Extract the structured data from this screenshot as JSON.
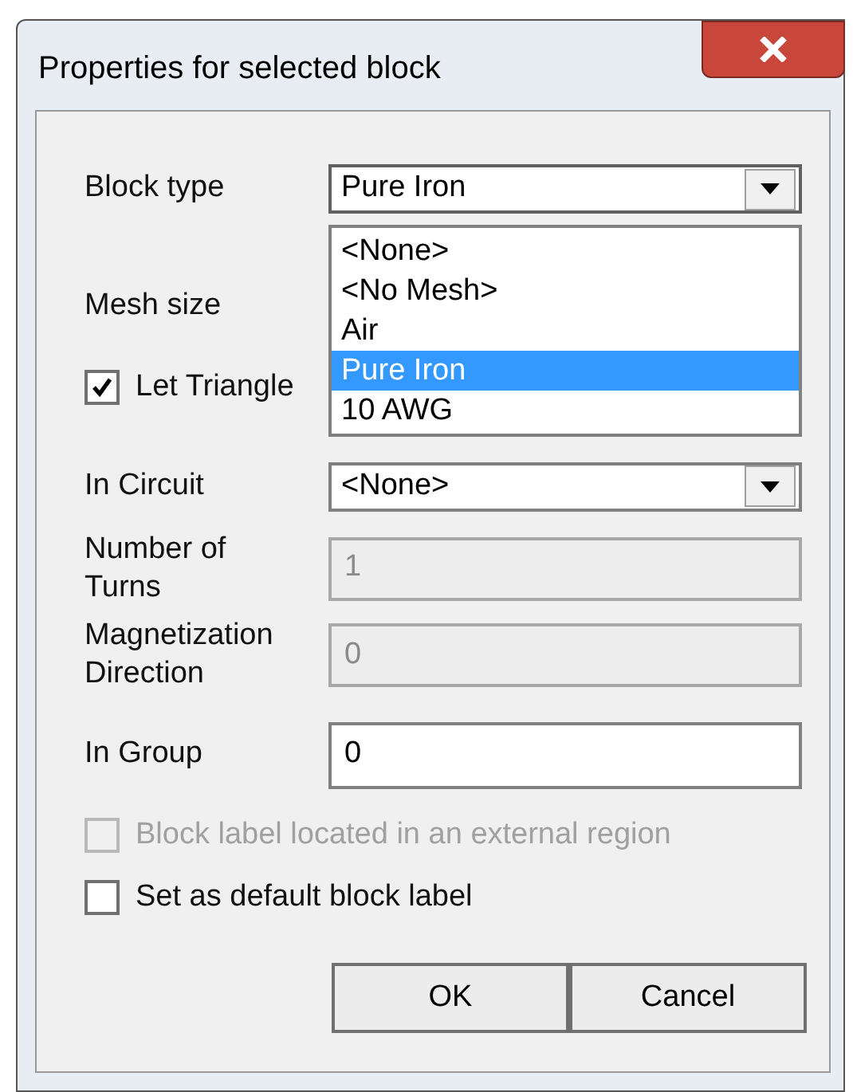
{
  "window": {
    "title": "Properties for selected block"
  },
  "block_type": {
    "label": "Block type",
    "value": "Pure Iron",
    "expanded": true,
    "options": [
      {
        "label": "<None>",
        "selected": false
      },
      {
        "label": "<No Mesh>",
        "selected": false
      },
      {
        "label": "Air",
        "selected": false
      },
      {
        "label": "Pure Iron",
        "selected": true
      },
      {
        "label": "10 AWG",
        "selected": false
      }
    ]
  },
  "mesh_size": {
    "label": "Mesh size"
  },
  "let_triangle": {
    "label": "Let Triangle",
    "checked": true
  },
  "in_circuit": {
    "label": "In Circuit",
    "value": "<None>",
    "expanded": false
  },
  "number_of_turns": {
    "label": "Number of Turns",
    "value": "1",
    "disabled": true
  },
  "magnetization_direction": {
    "label": "Magnetization Direction",
    "value": "0",
    "disabled": true
  },
  "in_group": {
    "label": "In Group",
    "value": "0",
    "disabled": false
  },
  "checkboxes": [
    {
      "label": "Block label located in an external region",
      "checked": false,
      "disabled": true
    },
    {
      "label": "Set as default block label",
      "checked": false,
      "disabled": false
    }
  ],
  "buttons": [
    {
      "label": "OK"
    },
    {
      "label": "Cancel"
    }
  ]
}
